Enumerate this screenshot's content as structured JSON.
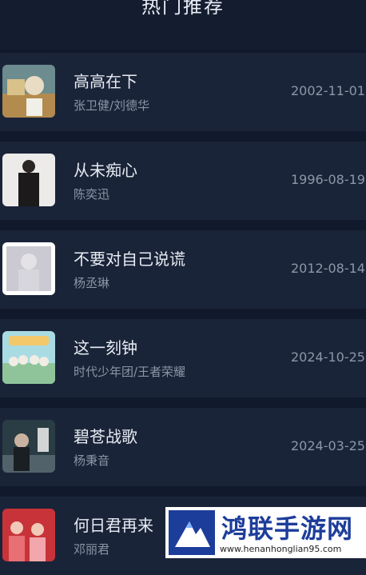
{
  "header": {
    "title": "热门推荐"
  },
  "songs": [
    {
      "title": "高高在下",
      "artist": "张卫健/刘德华",
      "date": "2002-11-01"
    },
    {
      "title": "从未痴心",
      "artist": "陈奕迅",
      "date": "1996-08-19"
    },
    {
      "title": "不要对自己说谎",
      "artist": "杨丞琳",
      "date": "2012-08-14"
    },
    {
      "title": "这一刻钟",
      "artist": "时代少年团/王者荣耀",
      "date": "2024-10-25"
    },
    {
      "title": "碧苍战歌",
      "artist": "杨秉音",
      "date": "2024-03-25"
    },
    {
      "title": "何日君再来",
      "artist": "邓丽君",
      "date": ""
    }
  ],
  "watermark": {
    "name": "鸿联手游网",
    "url": "www.henanhonglian95.com"
  },
  "colors": {
    "background": "#111a2c",
    "row": "#1a2438",
    "title": "#e8ecf3",
    "subtext": "#8b95a8"
  }
}
